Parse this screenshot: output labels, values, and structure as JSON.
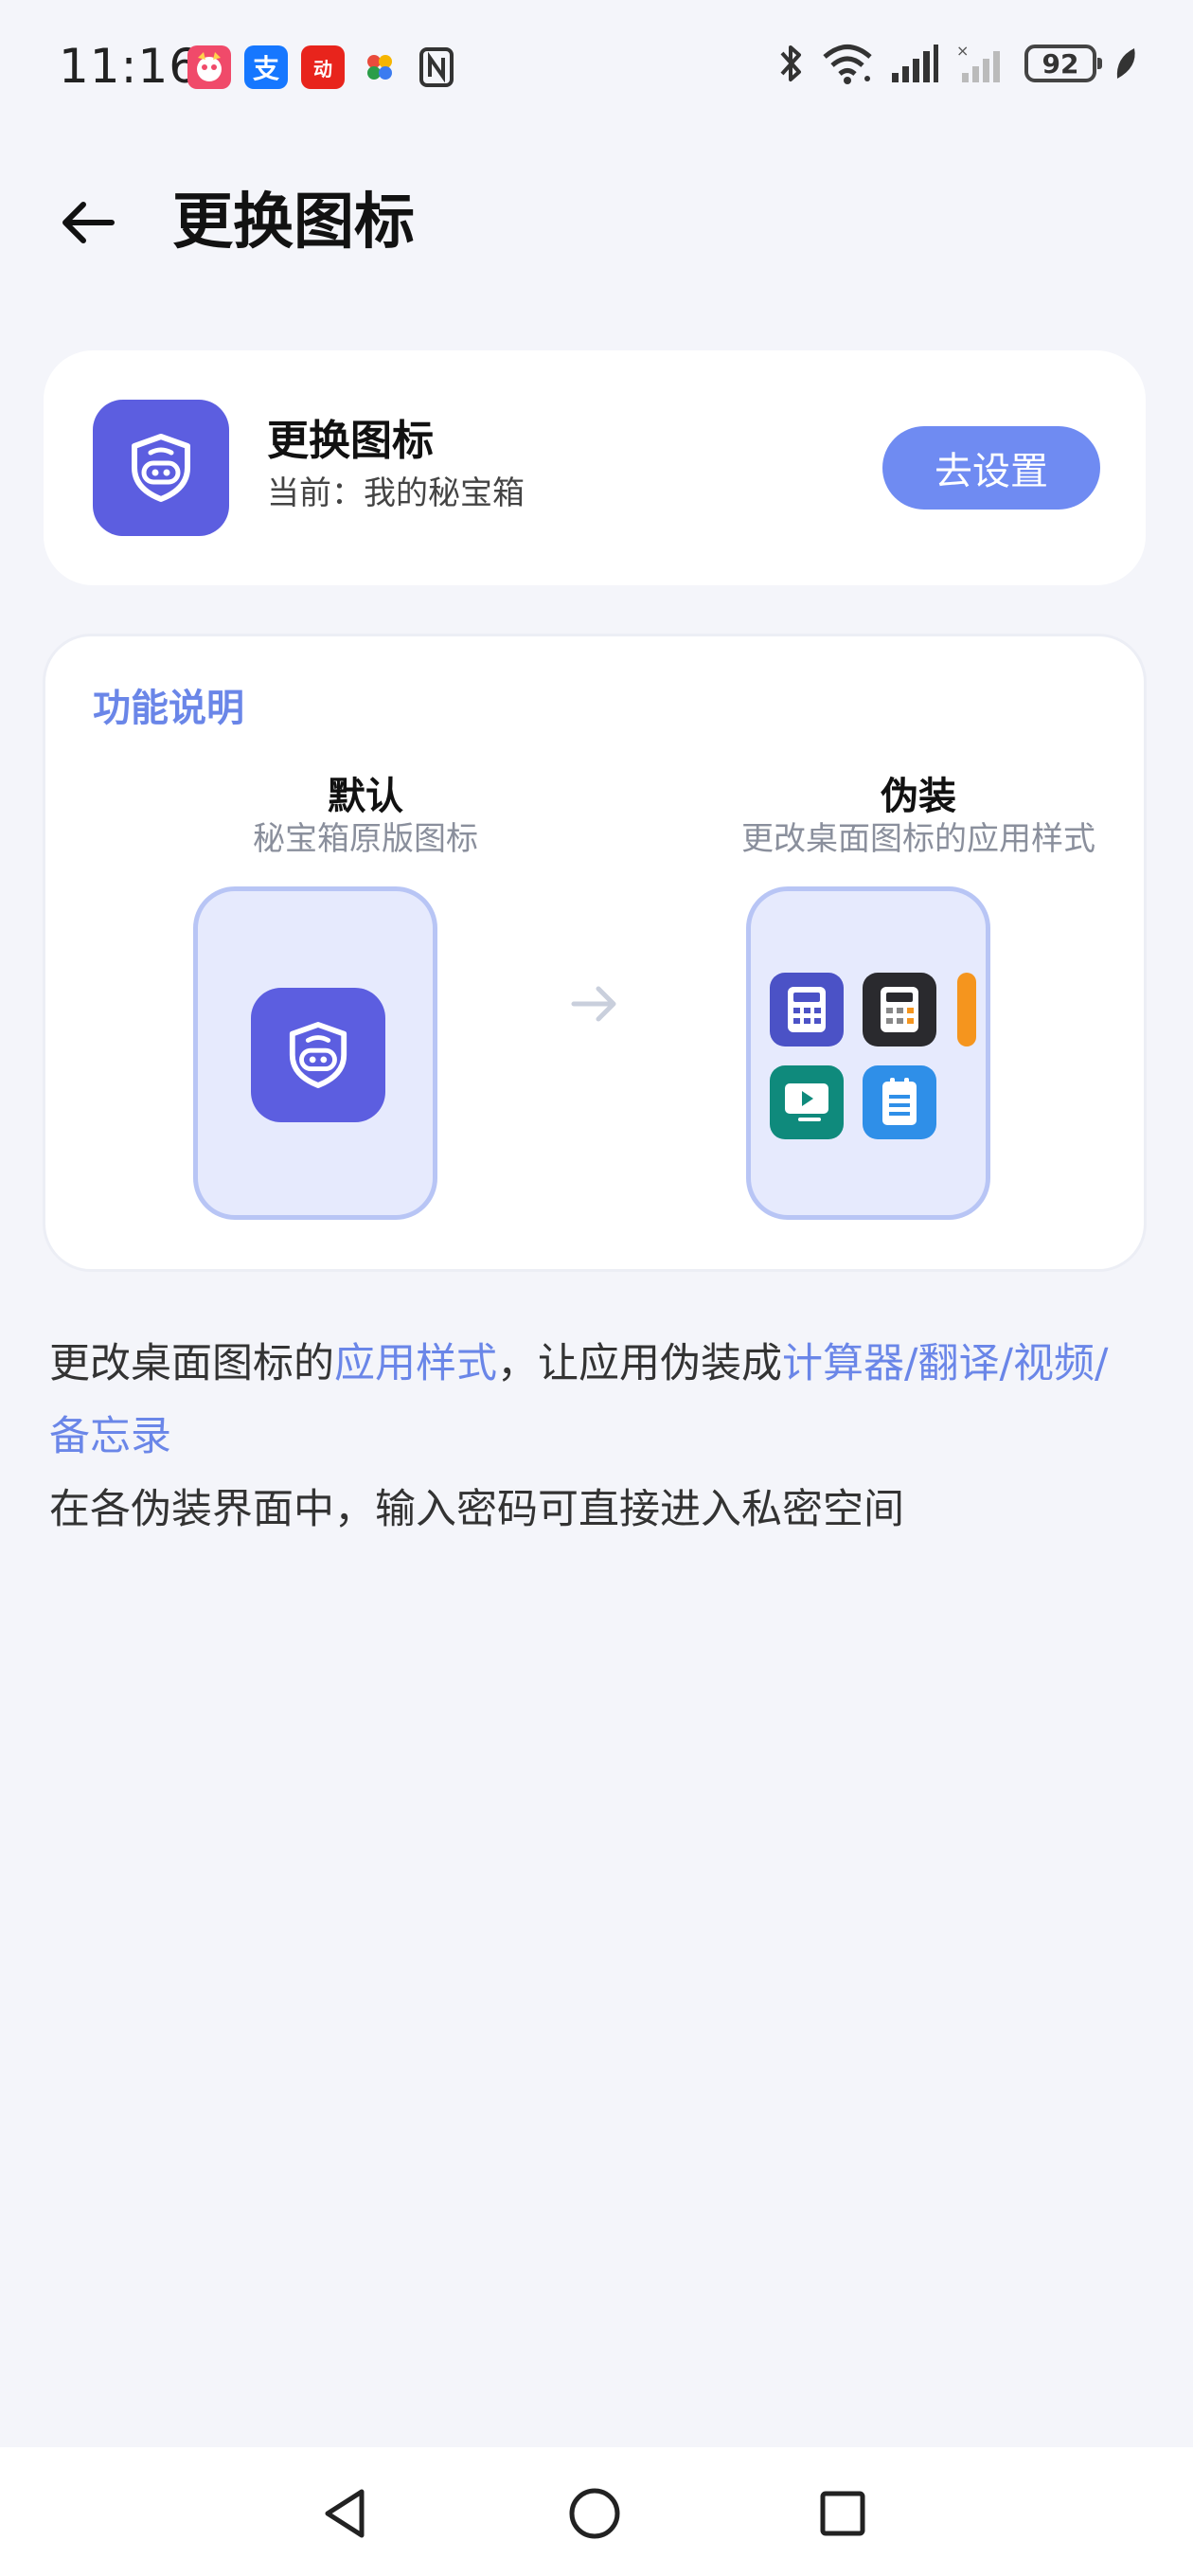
{
  "status_bar": {
    "time": "11:16",
    "notification_icons": [
      "app-icon-pink",
      "alipay-icon",
      "taobao-icon",
      "pinwheel-icon",
      "nfc-icon"
    ],
    "alipay_glyph": "支",
    "taobao_glyph": "动",
    "battery": "92"
  },
  "header": {
    "title": "更换图标"
  },
  "current": {
    "title": "更换图标",
    "subtitle": "当前：我的秘宝箱",
    "button_label": "去设置"
  },
  "feature": {
    "heading": "功能说明",
    "default_title": "默认",
    "default_subtitle": "秘宝箱原版图标",
    "disguise_title": "伪装",
    "disguise_subtitle": "更改桌面图标的应用样式",
    "disguise_icons": [
      "calculator-icon",
      "calculator-dark-icon",
      "video-icon",
      "notes-icon"
    ]
  },
  "description": {
    "line1_a": "更改桌面图标的",
    "line1_b": "应用样式",
    "line1_c": "，让应用伪装成",
    "line1_d": "计算器/翻译/视频/备忘录",
    "line2": "在各伪装界面中，输入密码可直接进入私密空间"
  },
  "nav": {
    "buttons": [
      "back-nav-icon",
      "home-nav-icon",
      "recents-nav-icon"
    ]
  },
  "colors": {
    "accent": "#6a86e8",
    "button": "#6f8bf2",
    "app_icon": "#5c5ee0",
    "background": "#f4f5fa"
  }
}
